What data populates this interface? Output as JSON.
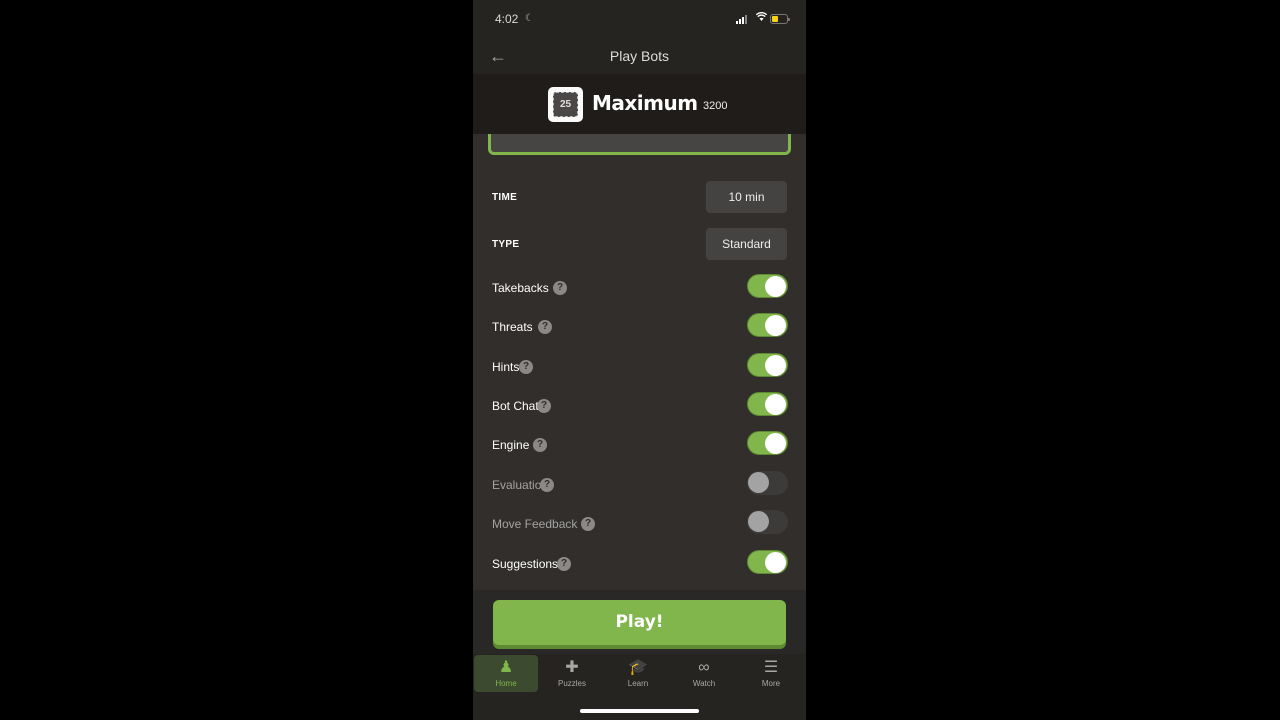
{
  "status_bar": {
    "time": "4:02",
    "moon_icon": "☾",
    "wifi_icon": "wifi-icon",
    "battery_icon": "battery-low-icon"
  },
  "nav": {
    "back_icon": "←",
    "title": "Play Bots"
  },
  "bot": {
    "level": "25",
    "name": "Maximum",
    "rating": "3200"
  },
  "settings": {
    "time_label": "TIME",
    "time_value": "10 min",
    "type_label": "TYPE",
    "type_value": "Standard",
    "help_glyph": "?",
    "toggles": [
      {
        "label": "Takebacks",
        "on": true,
        "enabled": true
      },
      {
        "label": "Threats",
        "on": true,
        "enabled": true
      },
      {
        "label": "Hints",
        "on": true,
        "enabled": true
      },
      {
        "label": "Bot Chat",
        "on": true,
        "enabled": true
      },
      {
        "label": "Engine",
        "on": true,
        "enabled": true
      },
      {
        "label": "Evaluation",
        "on": false,
        "enabled": false
      },
      {
        "label": "Move Feedback",
        "on": false,
        "enabled": false
      },
      {
        "label": "Suggestions",
        "on": true,
        "enabled": true
      }
    ]
  },
  "play_button": "Play!",
  "tabbar": {
    "tabs": [
      {
        "label": "Home",
        "icon": "♟",
        "active": true
      },
      {
        "label": "Puzzles",
        "icon": "✚",
        "active": false
      },
      {
        "label": "Learn",
        "icon": "🎓",
        "active": false
      },
      {
        "label": "Watch",
        "icon": "∞",
        "active": false
      },
      {
        "label": "More",
        "icon": "☰",
        "active": false
      }
    ]
  },
  "colors": {
    "accent_green": "#81b64c",
    "background": "#312e2b",
    "header": "#262421"
  }
}
